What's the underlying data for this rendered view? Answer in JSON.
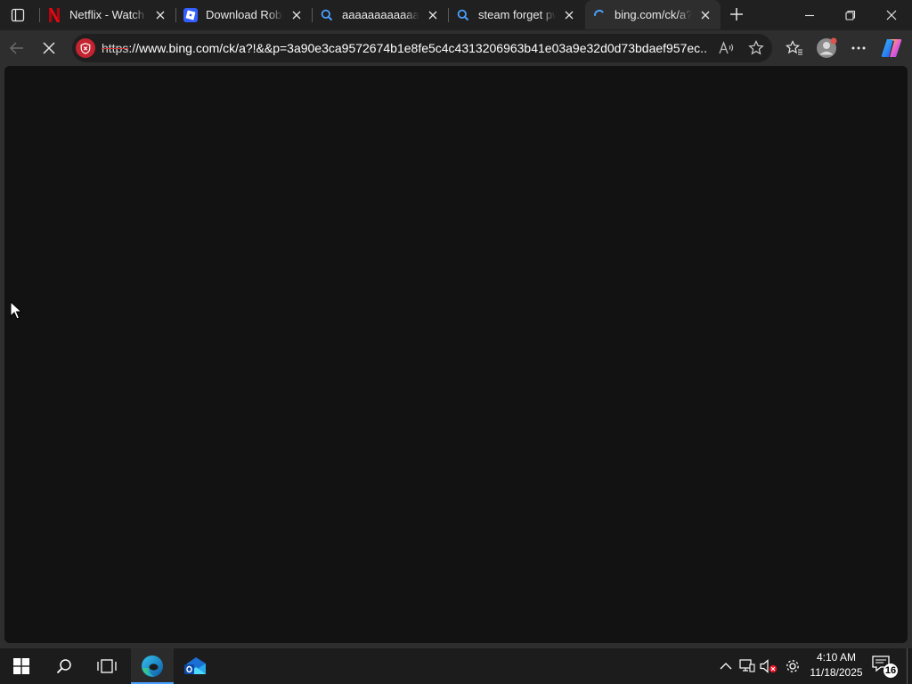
{
  "browser": {
    "tabs": [
      {
        "title": "Netflix - Watch TV",
        "favicon": "netflix-icon",
        "active": false
      },
      {
        "title": "Download Roblox",
        "favicon": "roblox-icon",
        "active": false
      },
      {
        "title": "aaaaaaaaaaaaa -",
        "favicon": "search-icon",
        "active": false
      },
      {
        "title": "steam forget pw",
        "favicon": "search-icon",
        "active": false
      },
      {
        "title": "bing.com/ck/a?!&",
        "favicon": "loading-spinner-icon",
        "active": true
      }
    ],
    "address_bar": {
      "url_scheme": "https",
      "url_rest": "://www.bing.com/ck/a?!&&p=3a90e3ca9572674b1e8fe5c4c4313206963b41e03a9e32d0d73bdaef957ec...",
      "security": "not-secure-shield-icon"
    },
    "toolbar_icons": [
      "back-arrow-icon",
      "stop-loading-icon",
      "read-aloud-icon",
      "add-favorite-star-icon",
      "favorites-icon",
      "profile-avatar-icon",
      "more-options-icon",
      "copilot-icon"
    ]
  },
  "page": {
    "background": "#121212",
    "state": "loading"
  },
  "taskbar": {
    "apps": [
      "start-icon",
      "search-icon",
      "task-view-icon",
      "edge-icon",
      "outlook-icon"
    ],
    "tray": [
      "show-hidden-icons-chevron",
      "network-icon",
      "volume-muted-icon",
      "settings-gear-icon"
    ],
    "time": "4:10 AM",
    "date": "11/18/2025",
    "notification_count": "16"
  },
  "colors": {
    "accent": "#4aa0ff",
    "security_warning": "#c4242f",
    "netflix": "#e50914",
    "roblox": "#335fff"
  }
}
